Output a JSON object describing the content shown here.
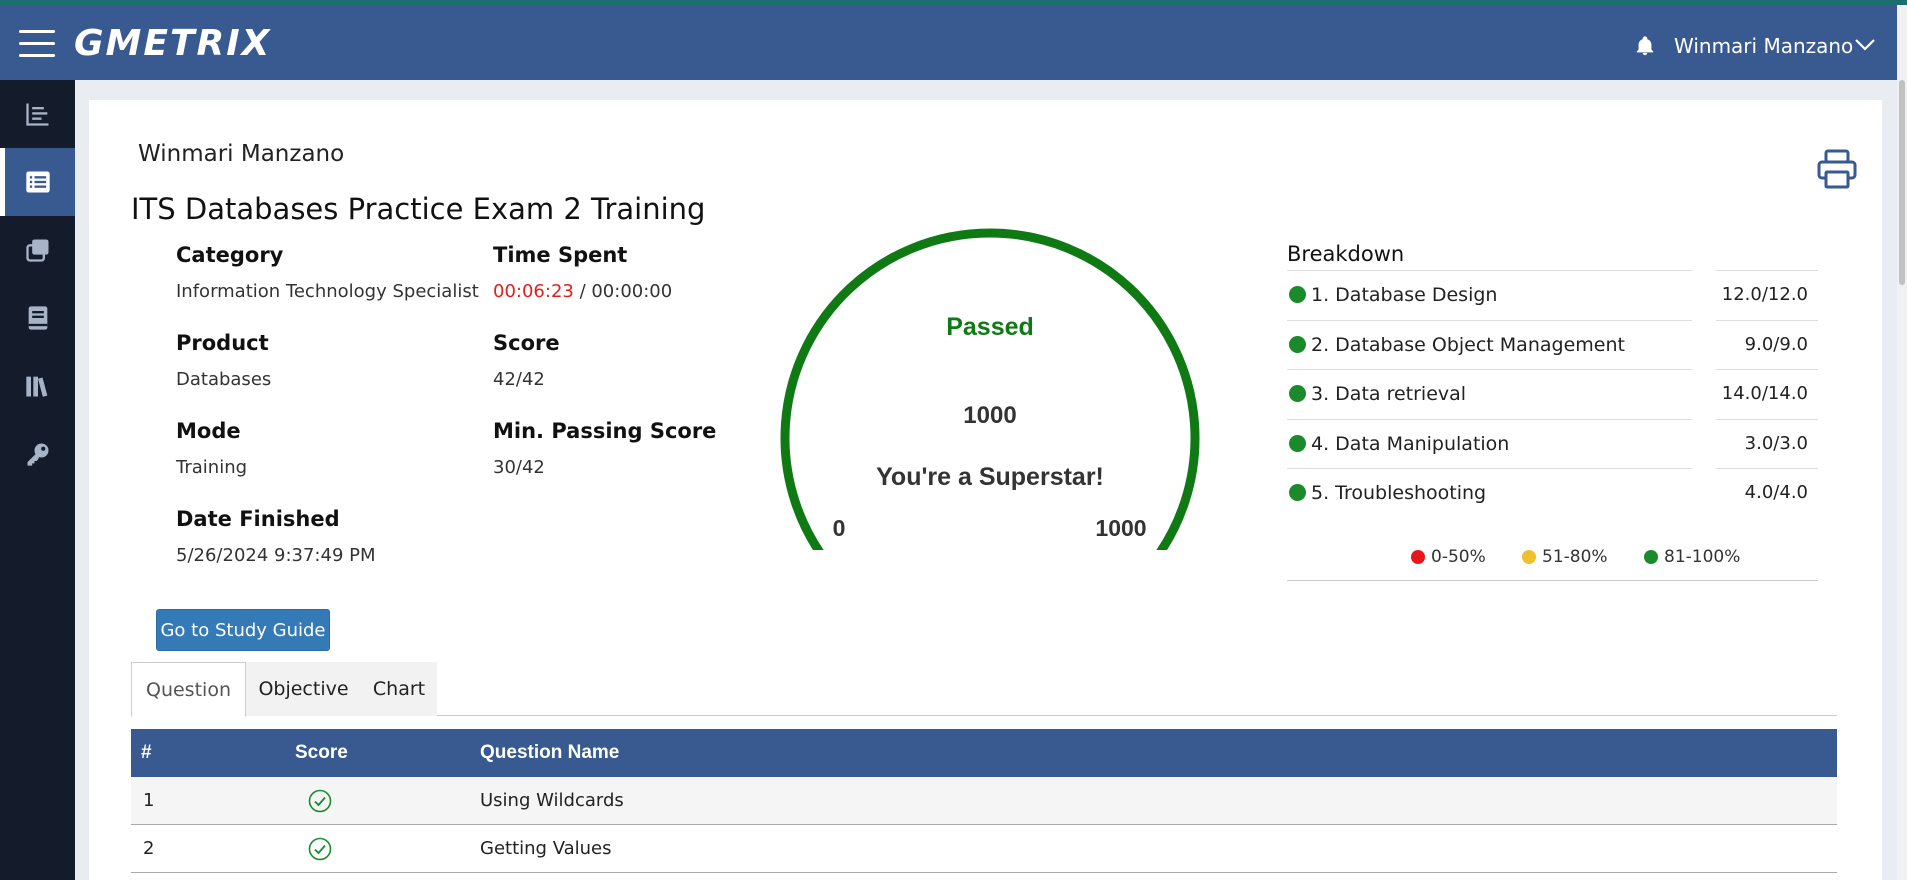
{
  "header": {
    "logo": "GMETRIX",
    "user_name": "Winmari Manzano"
  },
  "sidebar": {
    "items": [
      {
        "icon": "bar-chart-icon"
      },
      {
        "icon": "list-icon",
        "active": true
      },
      {
        "icon": "copy-icon"
      },
      {
        "icon": "book-icon"
      },
      {
        "icon": "library-icon"
      },
      {
        "icon": "key-icon"
      }
    ]
  },
  "report": {
    "student_name": "Winmari Manzano",
    "exam_title": "ITS Databases Practice Exam 2 Training",
    "category_label": "Category",
    "category_value": "Information Technology Specialist",
    "time_label": "Time Spent",
    "time_spent": "00:06:23",
    "time_limit": " / 00:00:00",
    "product_label": "Product",
    "product_value": "Databases",
    "score_label": "Score",
    "score_value": "42/42",
    "mode_label": "Mode",
    "mode_value": "Training",
    "min_pass_label": "Min. Passing Score",
    "min_pass_value": "30/42",
    "date_label": "Date Finished",
    "date_value": "5/26/2024 9:37:49 PM"
  },
  "gauge": {
    "status": "Passed",
    "score": "1000",
    "message": "You're a Superstar!",
    "min": "0",
    "max": "1000",
    "fraction": 1.0,
    "color": "#0f7a14"
  },
  "breakdown": {
    "title": "Breakdown",
    "items": [
      {
        "label": "1. Database Design",
        "score": "12.0/12.0"
      },
      {
        "label": "2. Database Object Management",
        "score": "9.0/9.0"
      },
      {
        "label": "3. Data retrieval",
        "score": "14.0/14.0"
      },
      {
        "label": "4. Data Manipulation",
        "score": "3.0/3.0"
      },
      {
        "label": "5. Troubleshooting",
        "score": "4.0/4.0"
      }
    ],
    "legend": [
      {
        "label": "0-50%",
        "color": "#e8161b"
      },
      {
        "label": "51-80%",
        "color": "#f0c02f"
      },
      {
        "label": "81-100%",
        "color": "#1a8a2a"
      }
    ]
  },
  "study_button": "Go to Study Guide",
  "tabs": [
    "Question",
    "Objective",
    "Chart"
  ],
  "table": {
    "headers": [
      "#",
      "Score",
      "Question Name"
    ],
    "rows": [
      {
        "num": "1",
        "name": "Using Wildcards"
      },
      {
        "num": "2",
        "name": "Getting Values"
      }
    ]
  }
}
